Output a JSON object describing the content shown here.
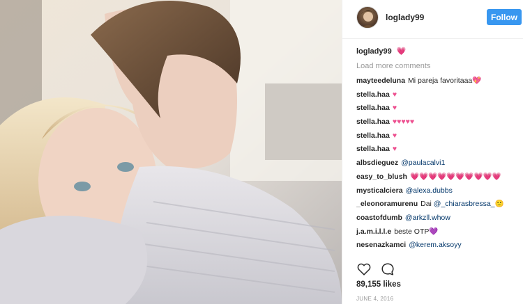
{
  "post": {
    "username": "loglady99",
    "follow_label": "Follow",
    "caption_user": "loglady99",
    "caption_text": "💗",
    "load_more": "Load more comments",
    "likes": "89,155 likes",
    "date": "JUNE 4, 2016"
  },
  "comments": [
    {
      "user": "mayteedeluna",
      "text": "Mi pareja favoritaaa💖",
      "mention": ""
    },
    {
      "user": "stella.haa",
      "text": "♥",
      "mention": ""
    },
    {
      "user": "stella.haa",
      "text": "♥",
      "mention": ""
    },
    {
      "user": "stella.haa",
      "text": "♥♥♥♥♥",
      "mention": ""
    },
    {
      "user": "stella.haa",
      "text": "♥",
      "mention": ""
    },
    {
      "user": "stella.haa",
      "text": "♥",
      "mention": ""
    },
    {
      "user": "albsdieguez",
      "text": "",
      "mention": "@paulacalvi1"
    },
    {
      "user": "easy_to_blush",
      "text": "💗💗💗💗💗💗💗💗💗💗",
      "mention": ""
    },
    {
      "user": "mysticalciera",
      "text": "",
      "mention": "@alexa.dubbs"
    },
    {
      "user": "_eleonoramurenu",
      "text": "Dai",
      "mention": "@_chiarasbressa_",
      "suffix": "🙂"
    },
    {
      "user": "coastofdumb",
      "text": "",
      "mention": "@arkzll.whow"
    },
    {
      "user": "j.a.m.i.l.l.e",
      "text": "beste OTP",
      "mention": "",
      "suffix": "💜"
    },
    {
      "user": "nesenazkamci",
      "text": "",
      "mention": "@kerem.aksoyy"
    }
  ],
  "icons": {
    "like": "heart-outline-icon",
    "comment": "speech-bubble-icon"
  },
  "colors": {
    "follow_button": "#3897f0",
    "mention": "#003569",
    "muted": "#999999"
  }
}
